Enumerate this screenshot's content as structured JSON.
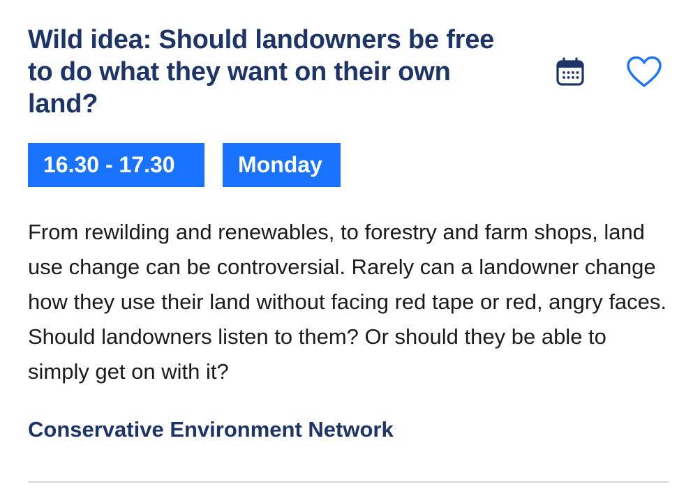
{
  "event": {
    "title": "Wild idea: Should landowners be free to do what they want on their own land?",
    "time": "16.30 - 17.30",
    "day": "Monday",
    "description": "From rewilding and renewables, to forestry and farm shops, land use change can be controversial. Rarely can a landowner change how they use their land without facing red tape or red, angry faces. Should landowners listen to them? Or should they be able to simply get on with it?",
    "organizer": "Conservative Environment Network"
  },
  "icons": {
    "calendar": "calendar-icon",
    "favorite": "heart-icon"
  },
  "colors": {
    "title": "#1c3467",
    "tag_background": "#1a73ff",
    "tag_text": "#ffffff",
    "body_text": "#1b1b1b",
    "divider": "#d6d6d6"
  }
}
